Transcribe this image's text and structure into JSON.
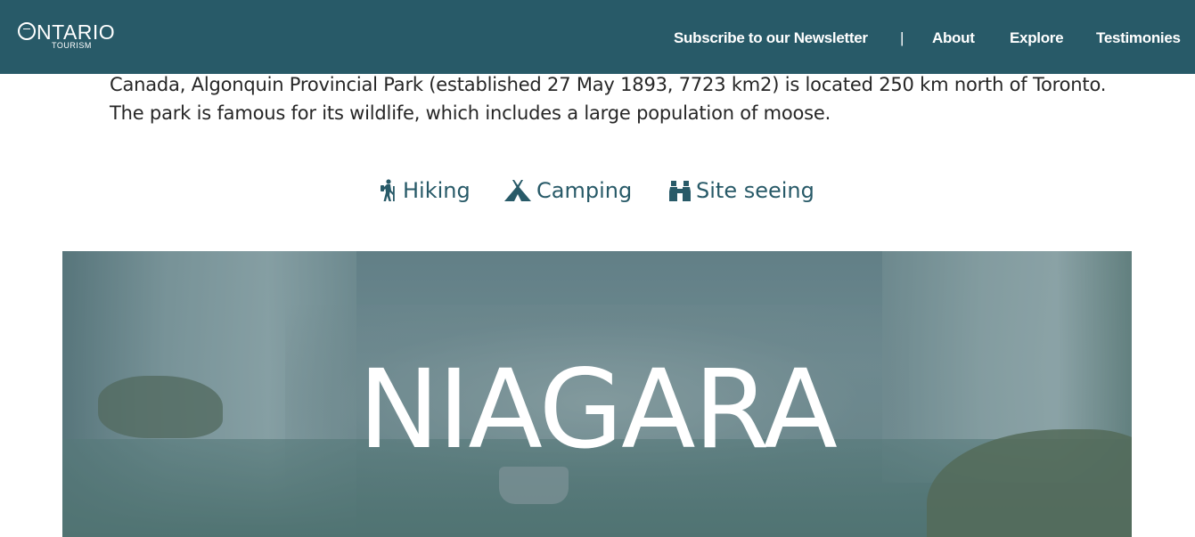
{
  "header": {
    "logo_title": "ONTARIO",
    "logo_subtitle": "TOURISM",
    "nav": {
      "newsletter": "Subscribe to our Newsletter",
      "separator": "|",
      "about": "About",
      "explore": "Explore",
      "testimonies": "Testimonies"
    }
  },
  "intro": {
    "text": "Canada, Algonquin Provincial Park (established 27 May 1893, 7723 km2) is located 250 km north of Toronto. The park is famous for its wildlife, which includes a large population of moose."
  },
  "activities": {
    "hiking": {
      "label": "Hiking",
      "icon": "hiking-icon"
    },
    "camping": {
      "label": "Camping",
      "icon": "tent-icon"
    },
    "sightseeing": {
      "label": "Site seeing",
      "icon": "binoculars-icon"
    }
  },
  "banner": {
    "title": "NIAGARA"
  },
  "colors": {
    "brand": "#285a68",
    "text": "#262626",
    "white": "#ffffff"
  }
}
